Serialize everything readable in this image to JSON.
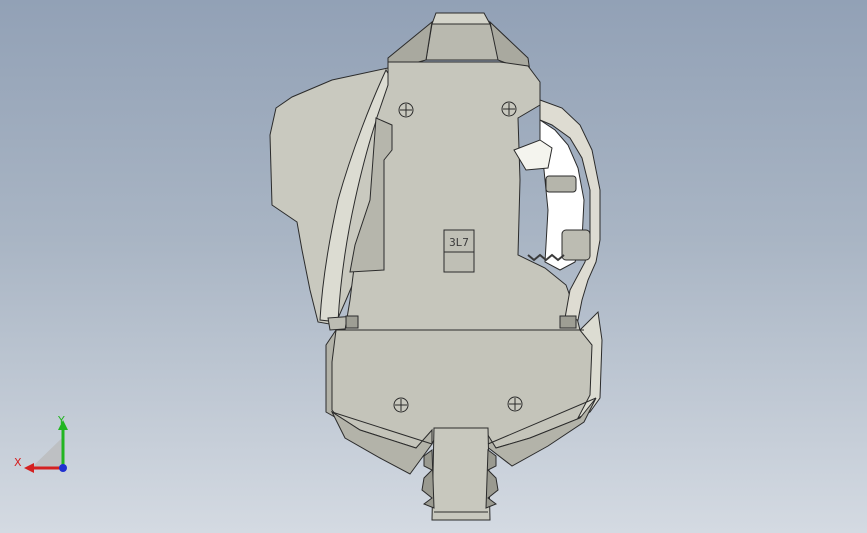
{
  "viewport": {
    "background_top": "#92a1b6",
    "background_bottom": "#d4dae2"
  },
  "model": {
    "body_fill": "#c6c6bc",
    "body_dark": "#8f8f86",
    "edge_color": "#2b2b2b",
    "engraving_text": "3L7"
  },
  "triad": {
    "x_label": "X",
    "y_label": "Y",
    "x_color": "#d42020",
    "y_color": "#22b522",
    "z_color": "#2030d0"
  }
}
